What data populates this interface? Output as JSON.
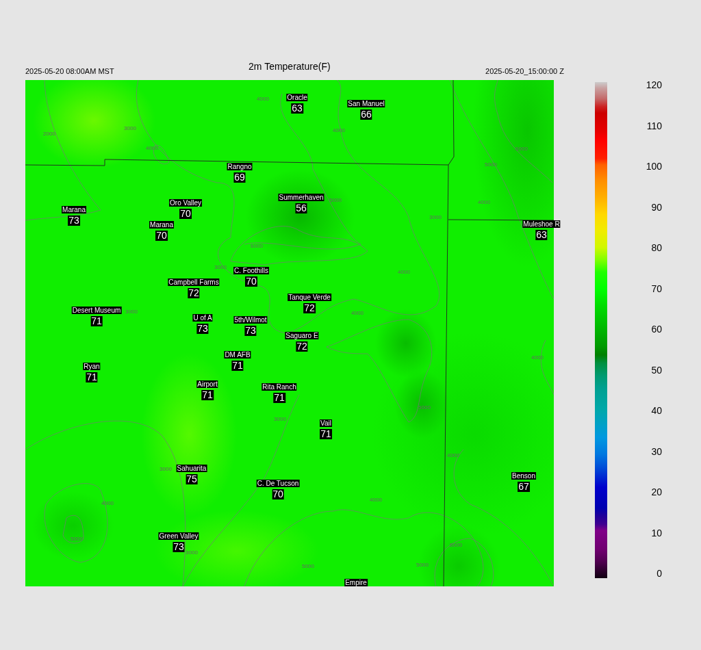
{
  "header": {
    "valid_local": "2025-05-20 08:00AM MST",
    "title": "2m Temperature(F)",
    "valid_utc": "2025-05-20_15:00:00 Z"
  },
  "stations": [
    {
      "name": "Oracle",
      "value": "63"
    },
    {
      "name": "San Manuel",
      "value": "66"
    },
    {
      "name": "Rangno",
      "value": "69"
    },
    {
      "name": "Summerhaven",
      "value": "56"
    },
    {
      "name": "Marana",
      "value": "73"
    },
    {
      "name": "Oro Valley",
      "value": "70"
    },
    {
      "name": "Marana",
      "value": "70"
    },
    {
      "name": "Muleshoe R",
      "value": "63"
    },
    {
      "name": "C. Foothills",
      "value": "70"
    },
    {
      "name": "Campbell Farms",
      "value": "72"
    },
    {
      "name": "Tanque Verde",
      "value": "72"
    },
    {
      "name": "Desert Museum",
      "value": "71"
    },
    {
      "name": "U of A",
      "value": "73"
    },
    {
      "name": "5th/Wilmot",
      "value": "73"
    },
    {
      "name": "Saguaro E",
      "value": "72"
    },
    {
      "name": "DM AFB",
      "value": "71"
    },
    {
      "name": "Ryan",
      "value": "71"
    },
    {
      "name": "Airport",
      "value": "71"
    },
    {
      "name": "Rita Ranch",
      "value": "71"
    },
    {
      "name": "Vail",
      "value": "71"
    },
    {
      "name": "Sahuarita",
      "value": "75"
    },
    {
      "name": "C. De Tucson",
      "value": "70"
    },
    {
      "name": "Benson",
      "value": "67"
    },
    {
      "name": "Green Valley",
      "value": "73"
    },
    {
      "name": "Empire"
    }
  ],
  "contour_labels": [
    "2000",
    "3000",
    "4000",
    "4000",
    "4000",
    "5000",
    "6000",
    "3000",
    "4000",
    "3000",
    "5000",
    "4000",
    "6000",
    "3000",
    "4000",
    "4000",
    "5000",
    "3000",
    "3000",
    "4000",
    "5000",
    "4000",
    "4000",
    "3000",
    "5000",
    "5000",
    "6000"
  ],
  "colorbar": {
    "ticks": [
      "120",
      "110",
      "100",
      "90",
      "80",
      "70",
      "60",
      "50",
      "40",
      "30",
      "20",
      "10",
      "0"
    ]
  }
}
